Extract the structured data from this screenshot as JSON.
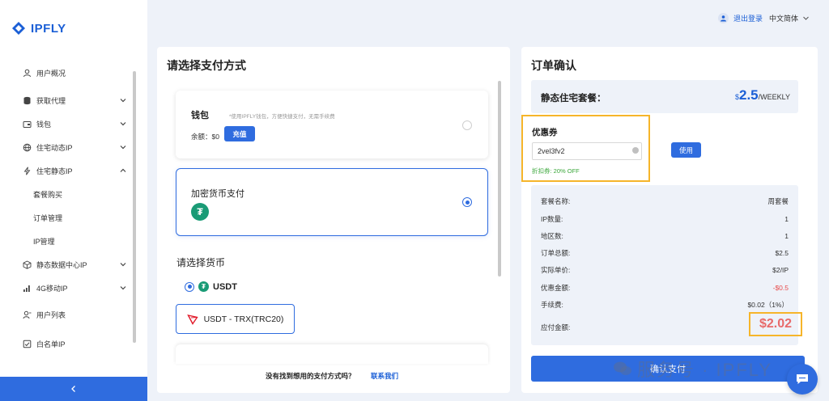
{
  "brand": {
    "name": "IPFLY",
    "color": "#1b5fd6"
  },
  "sidebar": {
    "items": [
      {
        "label": "用户概况",
        "icon": "user-icon",
        "expandable": false
      },
      {
        "label": "获取代理",
        "icon": "database-icon",
        "expandable": true
      },
      {
        "label": "钱包",
        "icon": "wallet-icon",
        "expandable": true
      },
      {
        "label": "住宅动态IP",
        "icon": "globe-icon",
        "expandable": true
      },
      {
        "label": "住宅静态IP",
        "icon": "lightning-icon",
        "expandable": true,
        "expanded": true
      },
      {
        "label": "套餐购买",
        "sub": true
      },
      {
        "label": "订单管理",
        "sub": true
      },
      {
        "label": "IP管理",
        "sub": true
      },
      {
        "label": "静态数据中心IP",
        "icon": "box-icon",
        "expandable": true
      },
      {
        "label": "4G移动IP",
        "icon": "signal-icon",
        "expandable": true
      },
      {
        "label": "用户列表",
        "icon": "user-list-icon",
        "expandable": false
      },
      {
        "label": "白名单IP",
        "icon": "whitelist-icon",
        "expandable": false
      }
    ]
  },
  "header": {
    "logout": "退出登录",
    "language": "中文简体"
  },
  "payment": {
    "title": "请选择支付方式",
    "wallet": {
      "title": "钱包",
      "note": "*使用IPFLY钱包，方便快捷支付，无需手续费",
      "balance_label": "余额：$0",
      "recharge": "充值"
    },
    "crypto": {
      "title": "加密货币支付",
      "icon_glyph": "₮"
    },
    "choose_currency": "请选择货币",
    "currency_option": "USDT",
    "network_button": "USDT - TRX(TRC20)",
    "footer_question": "没有找到想用的支付方式吗？",
    "footer_link": "联系我们"
  },
  "order": {
    "title": "订单确认",
    "package_label": "静态住宅套餐：",
    "price_currency": "$",
    "price_amount": "2.5",
    "price_period": "/WEEKLY",
    "coupon": {
      "title": "优惠券",
      "code": "2vel3fv2",
      "discount_note": "折扣券: 20% OFF",
      "use_button": "使用"
    },
    "summary": [
      {
        "label": "套餐名称:",
        "value": "周套餐"
      },
      {
        "label": "IP数量:",
        "value": "1"
      },
      {
        "label": "地区数:",
        "value": "1"
      },
      {
        "label": "订单总额:",
        "value": "$2.5"
      },
      {
        "label": "实际单价:",
        "value": "$2/IP"
      },
      {
        "label": "优惠金额:",
        "value": "-$0.5",
        "negative": true
      },
      {
        "label": "手续费:",
        "value": "$0.02（1%）"
      }
    ],
    "due_label": "应付金额:",
    "due_amount": "$2.02",
    "confirm_button": "确认支付"
  },
  "watermark": "服务号 · IPFLY",
  "colors": {
    "accent": "#2f6cdf",
    "highlight": "#f6b52a",
    "discount_red": "#e86a6a",
    "success_green": "#3aa73a"
  }
}
